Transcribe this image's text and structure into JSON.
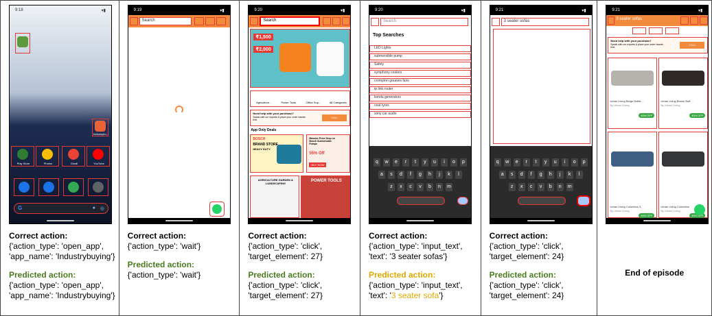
{
  "panels": [
    {
      "time": "9:18",
      "app_label": "Industrybu...",
      "dock_labels": [
        "Play Store",
        "Photos",
        "Gmail",
        "YouTube"
      ],
      "correct_heading": "Correct action:",
      "correct_text": "{'action_type': 'open_app', 'app_name': 'Industrybuying'}",
      "predicted_heading": "Predicted action:",
      "predicted_text": "{'action_type': 'open_app', 'app_name': 'Industrybuying'}"
    },
    {
      "time": "9:19",
      "search_placeholder": "Search",
      "correct_heading": "Correct action:",
      "correct_text": "{'action_type': 'wait'}",
      "predicted_heading": "Predicted action:",
      "predicted_text": "{'action_type': 'wait'}"
    },
    {
      "time": "9:20",
      "search_placeholder": "Search",
      "price1": "₹1,500",
      "price2": "₹2,000",
      "categories": [
        "Agriculture...",
        "Power Tools",
        "Office Sup...",
        "All Categories"
      ],
      "help_title": "Need help with your purchase?",
      "help_text": "Speak with our experts & place your order hassle-free.",
      "call_label": "CALL",
      "deals_heading": "App Only Deals",
      "brand1": "BOSCH",
      "brand1_sub": "BRAND STORE",
      "brand1_sub2": "HEAVY DUTY",
      "promo2_title": "Massive Price Drop on Bosch Submersible Pumps",
      "promo2_off": "55% Off",
      "promo2_btn": "BUY NOW",
      "tile1": "AGRICULTURE GARDEN & LANDSCAPING",
      "tile2": "POWER TOOLS",
      "correct_heading": "Correct action:",
      "correct_text": "{'action_type': 'click', 'target_element': 27}",
      "predicted_heading": "Predicted action:",
      "predicted_text": "{'action_type': 'click', 'target_element': 27}"
    },
    {
      "time": "9:20",
      "search_placeholder": "Search",
      "top_heading": "Top Searches",
      "searches": [
        "LED Lights",
        "submersible pump",
        "Safety",
        "symphony coolers",
        "crompton greaves fans",
        "tp link router",
        "konda generators",
        "ceat tyres",
        "sony car audio"
      ],
      "correct_heading": "Correct action:",
      "correct_prefix": "{'action_type': 'input_text', 'text': '3 seater sofas'}",
      "predicted_heading": "Predicted action:",
      "predicted_prefix": "{'action_type': 'input_text', 'text': '",
      "predicted_value": "3 seater sofa",
      "predicted_suffix": "'}"
    },
    {
      "time": "9:21",
      "search_value": "3 seater sofas",
      "correct_heading": "Correct action:",
      "correct_text": "{'action_type': 'click', 'target_element': 24}",
      "predicted_heading": "Predicted action:",
      "predicted_text": "{'action_type': 'click', 'target_element': 24}"
    },
    {
      "time": "9:21",
      "search_value": "3 seater sofas",
      "products": [
        {
          "name": "Urban Living Beige Buffal...",
          "brand": "By Urban Living",
          "off": "45% OFF"
        },
        {
          "name": "Urban Living Brown Buff...",
          "brand": "By Urban Living",
          "off": "45% OFF"
        },
        {
          "name": "Urban Living Columbus 3...",
          "brand": "By Urban Living",
          "off": "45% OFF"
        },
        {
          "name": "Urban Living Columbus",
          "brand": "By Urban Living",
          "off": "45% OFF"
        }
      ],
      "end_text": "End of episode"
    }
  ],
  "keyboard_rows": [
    [
      "q",
      "w",
      "e",
      "r",
      "t",
      "y",
      "u",
      "i",
      "o",
      "p"
    ],
    [
      "a",
      "s",
      "d",
      "f",
      "g",
      "h",
      "j",
      "k",
      "l"
    ],
    [
      "z",
      "x",
      "c",
      "v",
      "b",
      "n",
      "m"
    ]
  ],
  "colors": {
    "accent": "#f48a3c",
    "box": "#e53935",
    "green": "#4a7a1e",
    "yellow": "#e0a800"
  }
}
